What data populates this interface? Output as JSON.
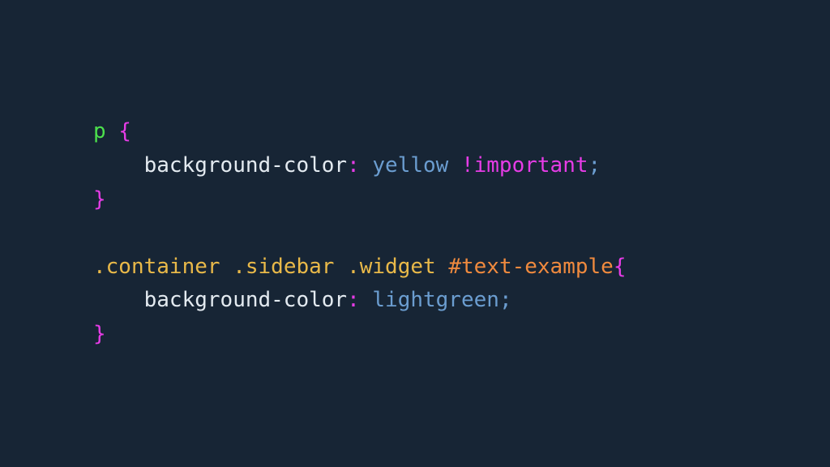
{
  "code": {
    "rule1": {
      "selector": "p",
      "brace_open": " {",
      "indent": "    ",
      "property": "background-color",
      "colon": ":",
      "space": " ",
      "value": "yellow",
      "important": " !important",
      "semi": ";",
      "brace_close": "}"
    },
    "rule2": {
      "sel_class1": ".container",
      "sel_class2": ".sidebar",
      "sel_class3": ".widget",
      "sel_id": "#text-example",
      "brace_open": "{",
      "indent": "    ",
      "property": "background-color",
      "colon": ":",
      "space": " ",
      "value": "lightgreen",
      "semi": ";",
      "brace_close": "}"
    }
  }
}
